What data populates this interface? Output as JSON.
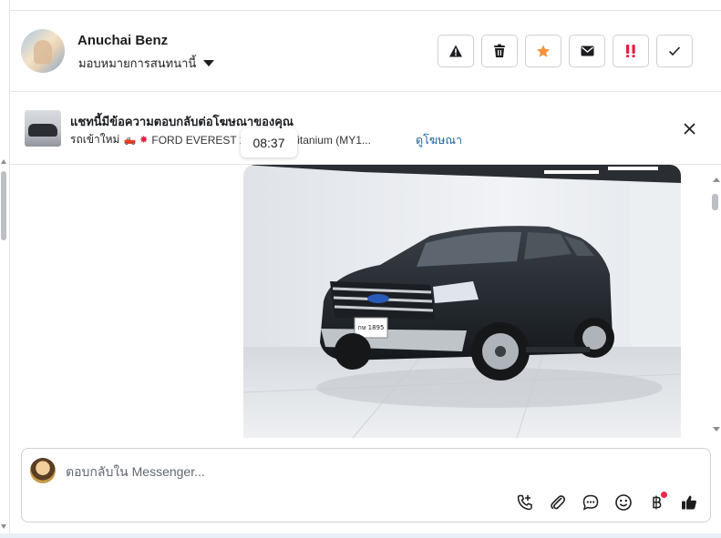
{
  "header": {
    "user_name": "Anuchai Benz",
    "assign_label": "มอบหมายการสนทนานี้",
    "actions": [
      "report-icon",
      "trash-icon",
      "star-icon",
      "mail-icon",
      "spam-icon",
      "check-icon"
    ],
    "colors": {
      "star": "#f7923b",
      "spam": "#e41e3f"
    }
  },
  "ad": {
    "title": "แชทนี้มีข้อความตอบกลับต่อโฆษณาของคุณ",
    "prefix": "รถเข้าใหม่",
    "car_name": "FORD EVEREST 2.2 Titanium (MY1...",
    "car_name_visible": "FORD EVEREST 2",
    "car_name_tail": "t 2.2 Titanium (MY1...",
    "view_ad_label": "ดูโฆษณา",
    "link_color": "#1a64a6"
  },
  "chat": {
    "timestamp": "08:37",
    "photo": {
      "plate_text": "กษ 1895",
      "description_icon": "car-photo"
    }
  },
  "composer": {
    "placeholder": "ตอบกลับใน Messenger...",
    "tools": [
      "call-plus-icon",
      "paperclip-icon",
      "chat-bubble-icon",
      "emoji-icon",
      "baht-icon",
      "thumbs-up-icon"
    ],
    "notification_color": "#f02849"
  }
}
